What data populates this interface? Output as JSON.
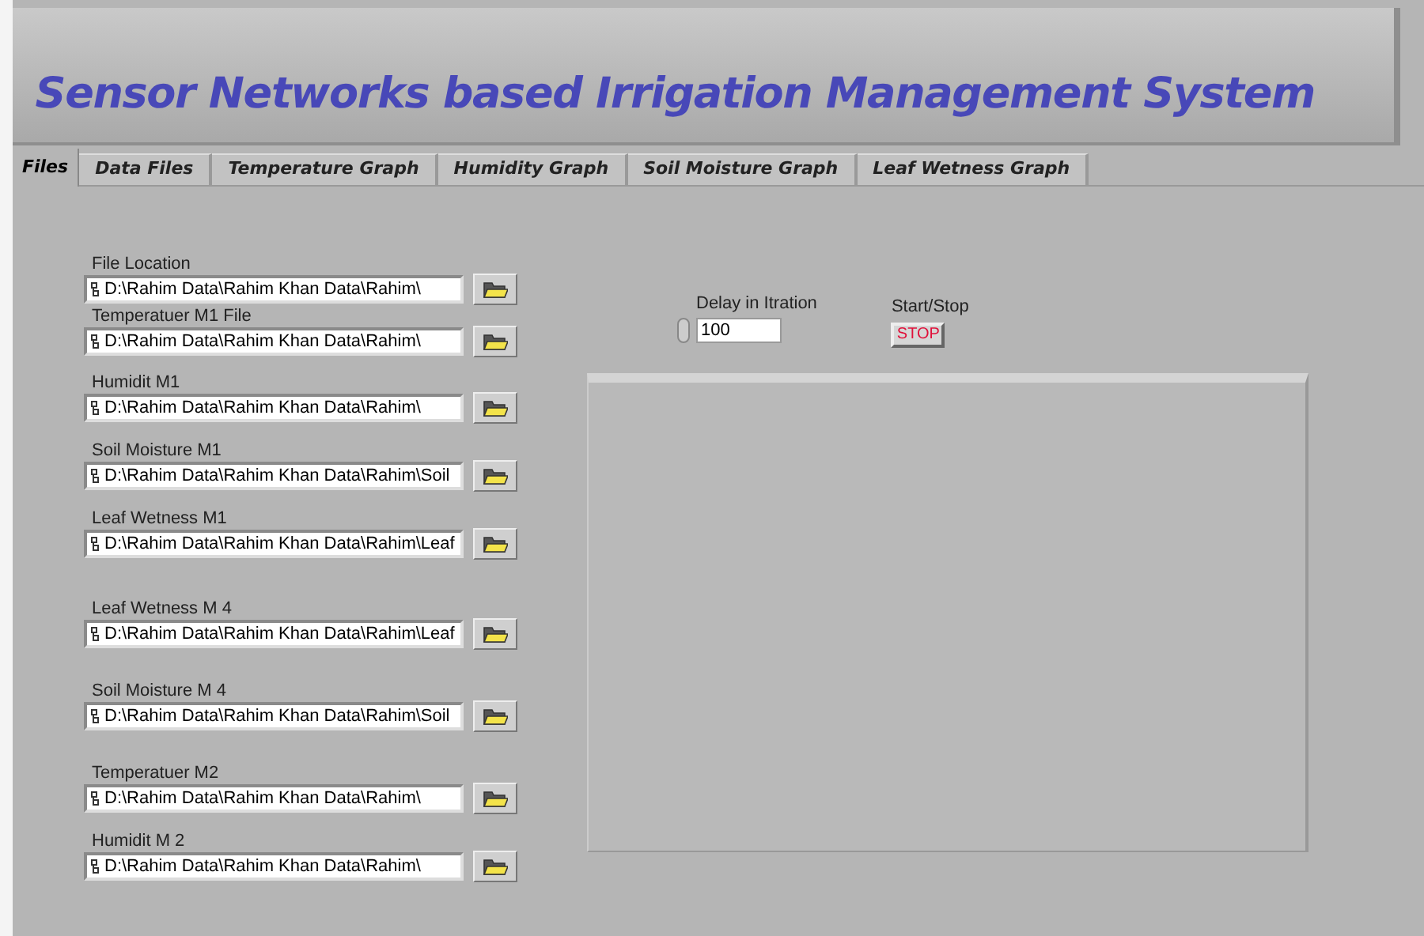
{
  "header": {
    "title": "Sensor Networks based Irrigation Management System"
  },
  "tabs": [
    {
      "label": "Files",
      "selected": true
    },
    {
      "label": "Data Files",
      "selected": false
    },
    {
      "label": "Temperature Graph",
      "selected": false
    },
    {
      "label": "Humidity Graph",
      "selected": false
    },
    {
      "label": "Soil Moisture Graph",
      "selected": false
    },
    {
      "label": "Leaf Wetness Graph",
      "selected": false
    }
  ],
  "file_paths": [
    {
      "label": "File Location",
      "value": "D:\\Rahim Data\\Rahim Khan Data\\Rahim\\"
    },
    {
      "label": "Temperatuer M1 File",
      "value": "D:\\Rahim Data\\Rahim Khan Data\\Rahim\\"
    },
    {
      "label": "Humidit M1",
      "value": "D:\\Rahim Data\\Rahim Khan Data\\Rahim\\"
    },
    {
      "label": "Soil Moisture M1",
      "value": "D:\\Rahim Data\\Rahim Khan Data\\Rahim\\Soil"
    },
    {
      "label": "Leaf Wetness M1",
      "value": "D:\\Rahim Data\\Rahim Khan Data\\Rahim\\Leaf"
    },
    {
      "label": "Leaf Wetness M 4",
      "value": "D:\\Rahim Data\\Rahim Khan Data\\Rahim\\Leaf"
    },
    {
      "label": "Soil Moisture M 4",
      "value": "D:\\Rahim Data\\Rahim Khan Data\\Rahim\\Soil"
    },
    {
      "label": "Temperatuer M2",
      "value": "D:\\Rahim Data\\Rahim Khan Data\\Rahim\\"
    },
    {
      "label": "Humidit M 2",
      "value": "D:\\Rahim Data\\Rahim Khan Data\\Rahim\\"
    }
  ],
  "delay": {
    "label": "Delay in Itration",
    "value": "100"
  },
  "start_stop": {
    "label": "Start/Stop",
    "button": "STOP"
  }
}
